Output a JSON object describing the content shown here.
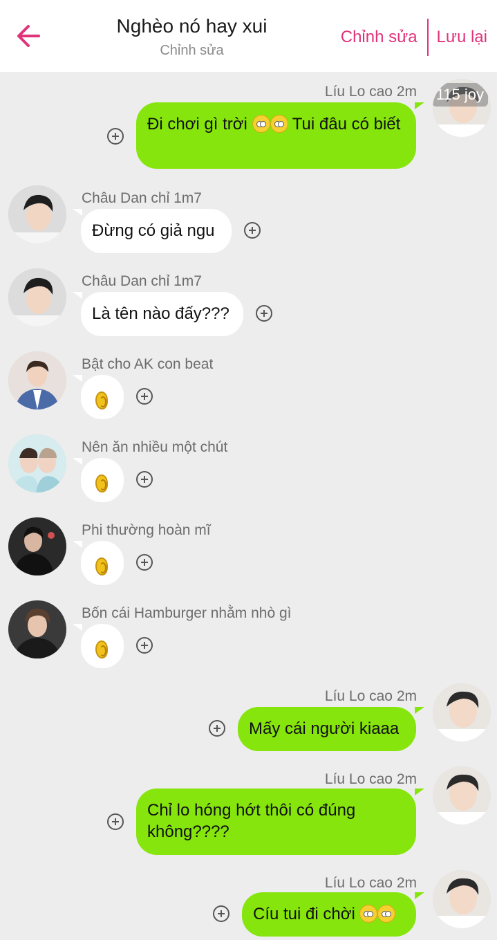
{
  "header": {
    "title": "Nghèo nó hay xui",
    "subtitle": "Chỉnh sửa",
    "edit_label": "Chỉnh sửa",
    "save_label": "Lưu lại"
  },
  "badge": {
    "text": "115 joy"
  },
  "messages": [
    {
      "sender": "Líu Lo cao 2m",
      "text": "Đi chơi gì trời Tui đâu có biết",
      "text_a": "Đi chơi gì trời",
      "text_b": " Tui đâu có biết",
      "side": "right"
    },
    {
      "sender": "Châu Dan chỉ 1m7",
      "text": "Đừng có giả ngu",
      "side": "left"
    },
    {
      "sender": "Châu Dan chỉ 1m7",
      "text": "Là tên nào đấy???",
      "side": "left"
    },
    {
      "sender": "Bật cho AK con beat",
      "text": "",
      "sticker": "ear-emoji",
      "side": "left"
    },
    {
      "sender": "Nên ăn nhiều một chút",
      "text": "",
      "sticker": "ear-emoji",
      "side": "left"
    },
    {
      "sender": "Phi thường hoàn mĩ",
      "text": "",
      "sticker": "ear-emoji",
      "side": "left"
    },
    {
      "sender": "Bốn cái Hamburger nhằm nhò gì",
      "text": "",
      "sticker": "ear-emoji",
      "side": "left"
    },
    {
      "sender": "Líu Lo cao 2m",
      "text": "Mấy cái người kiaaa",
      "side": "right"
    },
    {
      "sender": "Líu Lo cao 2m",
      "text": "Chỉ lo hóng hớt thôi có đúng không????",
      "side": "right"
    },
    {
      "sender": "Líu Lo cao 2m",
      "text": "Cíu tui đi chời",
      "side": "right"
    }
  ],
  "colors": {
    "accent": "#e0337a",
    "bubble_right": "#86e50c",
    "bubble_left": "#ffffff",
    "background": "#ededed"
  },
  "icons": [
    "back-arrow-icon",
    "plus-circle-icon",
    "ear-emoji",
    "eye-roll-emoji",
    "pleading-face-emoji"
  ]
}
